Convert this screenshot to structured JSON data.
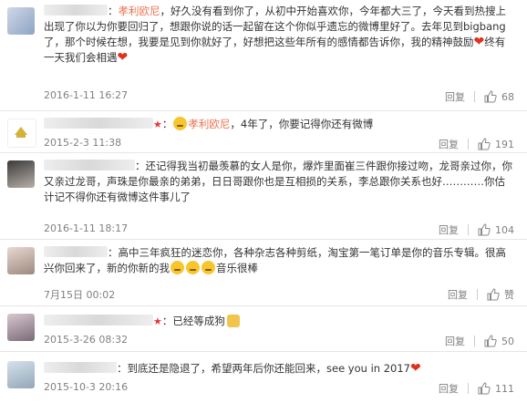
{
  "reply_label": "回复",
  "comments": [
    {
      "parts": [
        {
          "t": "blur",
          "w": 70
        },
        {
          "t": "text",
          "v": "："
        },
        {
          "t": "mention",
          "v": "孝利欧尼"
        },
        {
          "t": "text",
          "v": "，好久没有看到你了，从初中开始喜欢你，今年都大三了，今天看到热搜上出现了你以为你要回归了，想跟你说的话一起留在这个你似乎遗忘的微博里好了。去年见到bigbang了，那个时候在想，我要是见到你就好了，好想把这些年所有的感情都告诉你，我的精神鼓励"
        },
        {
          "t": "heart",
          "v": "❤"
        },
        {
          "t": "text",
          "v": "终有一天我们会相遇"
        },
        {
          "t": "heart",
          "v": "❤"
        }
      ],
      "time": "2016-1-11 16:27",
      "likes": "68",
      "like_icon": "thumb-up-icon"
    },
    {
      "parts": [
        {
          "t": "blur",
          "w": 120
        },
        {
          "t": "star",
          "v": "★"
        },
        {
          "t": "text",
          "v": "："
        },
        {
          "t": "face"
        },
        {
          "t": "mention",
          "v": "孝利欧尼"
        },
        {
          "t": "text",
          "v": "，4年了，你要记得你还有微博"
        }
      ],
      "time": "2015-2-3 11:38",
      "likes": "191",
      "like_icon": "thumb-up-icon"
    },
    {
      "parts": [
        {
          "t": "blur",
          "w": 100
        },
        {
          "t": "text",
          "v": "：还记得我当初最羡慕的女人是你，爆炸里面崔三件跟你接过吻，龙哥亲过你，你又亲过龙哥，声珠是你最亲的弟弟，日日哥跟你也是互相损的关系，李总跟你关系也好…………你估计记不得你还有微博这件事儿了"
        }
      ],
      "time": "2016-1-11 18:17",
      "likes": "104",
      "like_icon": "thumb-up-icon"
    },
    {
      "parts": [
        {
          "t": "blur",
          "w": 70
        },
        {
          "t": "text",
          "v": "：高中三年疯狂的迷恋你，各种杂志各种剪纸，淘宝第一笔订单是你的音乐专辑。很高兴你回来了，新的你新的我"
        },
        {
          "t": "face"
        },
        {
          "t": "face"
        },
        {
          "t": "face"
        },
        {
          "t": "text",
          "v": "音乐很棒"
        }
      ],
      "time": "7月15日 00:02",
      "likes": "赞",
      "like_icon": "thumb-up-icon"
    },
    {
      "parts": [
        {
          "t": "blur",
          "w": 120
        },
        {
          "t": "star",
          "v": "★"
        },
        {
          "t": "text",
          "v": "：已经等成狗"
        },
        {
          "t": "cat"
        }
      ],
      "time": "2015-3-26 08:32",
      "likes": "50",
      "like_icon": "thumb-up-icon"
    },
    {
      "parts": [
        {
          "t": "blur",
          "w": 80
        },
        {
          "t": "text",
          "v": "：到底还是隐退了，希望两年后你还能回来，see you in 2017"
        },
        {
          "t": "heart",
          "v": "❤"
        }
      ],
      "time": "2015-10-3 20:16",
      "likes": "111",
      "like_icon": "thumb-up-icon"
    }
  ]
}
